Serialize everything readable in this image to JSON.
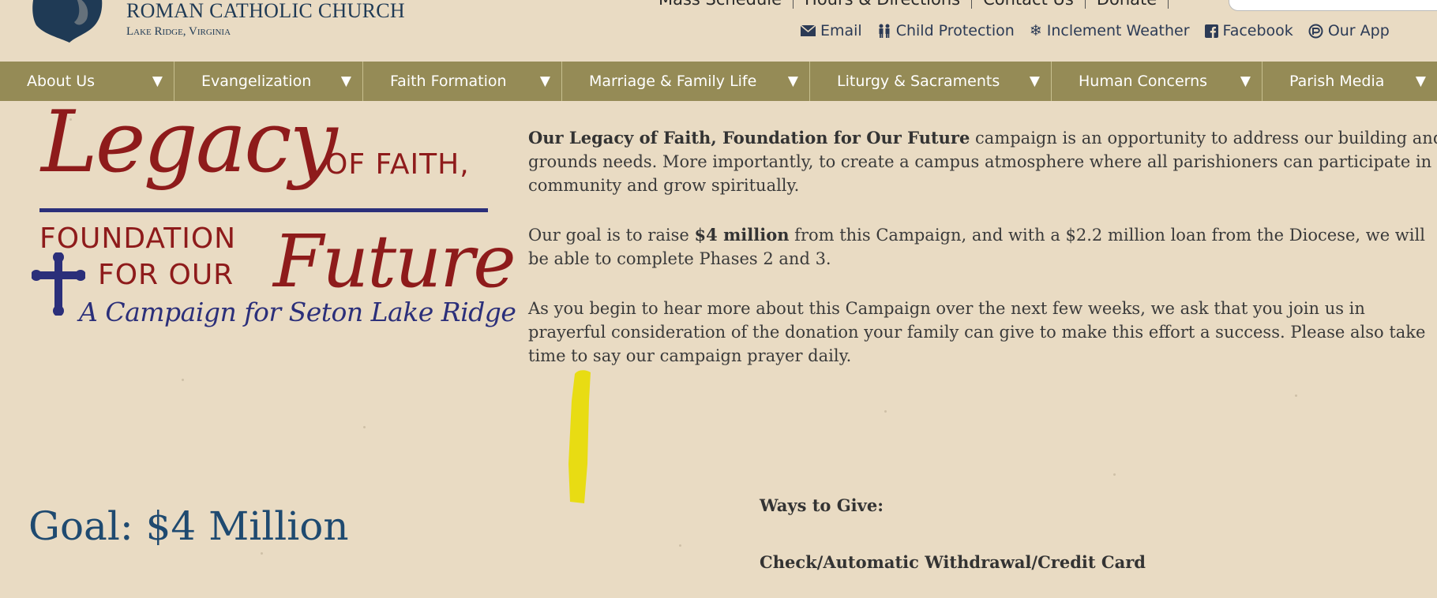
{
  "header": {
    "church_name": "ROMAN CATHOLIC CHURCH",
    "church_location": "Lake Ridge, Virginia",
    "top_links": [
      "Mass Schedule",
      "Hours & Directions",
      "Contact Us",
      "Donate"
    ],
    "utility_links": [
      {
        "label": "Email",
        "icon": "envelope-icon"
      },
      {
        "label": "Child Protection",
        "icon": "children-icon"
      },
      {
        "label": "Inclement Weather",
        "icon": "snowflake-icon"
      },
      {
        "label": "Facebook",
        "icon": "facebook-icon"
      },
      {
        "label": "Our App",
        "icon": "app-icon"
      }
    ]
  },
  "nav": {
    "items": [
      {
        "label": "About Us",
        "caret": "▼"
      },
      {
        "label": "Evangelization",
        "caret": "▼"
      },
      {
        "label": "Faith Formation",
        "caret": "▼"
      },
      {
        "label": "Marriage & Family Life",
        "caret": "▼"
      },
      {
        "label": "Liturgy & Sacraments",
        "caret": "▼"
      },
      {
        "label": "Human Concerns",
        "caret": "▼"
      },
      {
        "label": "Parish Media",
        "caret": "▼"
      }
    ]
  },
  "campaign_logo": {
    "legacy": "Legacy",
    "of_faith": "OF FAITH,",
    "foundation": "FOUNDATION",
    "for_our": "FOR OUR",
    "future": "Future",
    "tagline": "A Campaign for Seton Lake Ridge"
  },
  "content": {
    "p1_bold": "Our Legacy of Faith, Foundation for Our Future",
    "p1_rest": " campaign is an opportunity to address our building and grounds needs. More importantly, to create a campus atmosphere where all parishioners can participate in community and grow spiritually.",
    "p2_start": "Our goal is to raise ",
    "p2_bold": "$4 million",
    "p2_rest": " from this Campaign, and with a $2.2 million loan from the Diocese, we will be able to complete Phases 2 and 3.",
    "p3": "As you begin to hear more about this Campaign over the next few weeks, we ask that you join us in prayerful consideration of the donation your family can give to make this effort a success. Please also take time to say our campaign prayer daily.",
    "goal": "Goal: $4 Million",
    "ways_to_give": "Ways to Give:",
    "check_methods": "Check/Automatic Withdrawal/Credit Card"
  },
  "colors": {
    "background": "#e9dbc3",
    "nav": "#958b56",
    "navy": "#1f3a55",
    "maroon": "#8e1b1b",
    "highlight": "#e8dc00"
  }
}
